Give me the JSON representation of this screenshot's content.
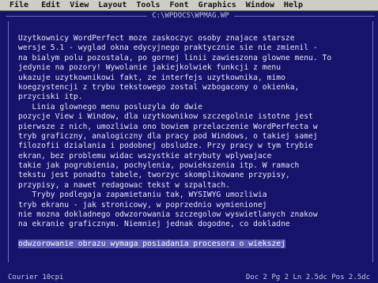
{
  "menu": {
    "items": [
      "File",
      "Edit",
      "View",
      "Layout",
      "Tools",
      "Font",
      "Graphics",
      "Window",
      "Help"
    ]
  },
  "window": {
    "title": "C:\\WPDOCS\\WPMAG.WP"
  },
  "document": {
    "lines": [
      "Uzytkownicy WordPerfect moze zaskoczyc osoby znajace starsze",
      "wersje 5.1 - wyglad okna edycyjnego praktycznie sie nie zmienil -",
      "na bialym polu pozostala, po gornej linii zawieszona glowne menu. To",
      "jedynie na pozory! Wywolanie jakiejkolwiek funkcji z menu",
      "ukazuje uzytkownikowi fakt, ze interfejs uzytkownika, mimo",
      "koegzystencji z trybu tekstowego zostal wzbogacony o okienka,",
      "przyciski itp.",
      "   Linia glownego menu posluzyla do dwie",
      "pozycje View i Window, dla uzytkownikow szczegolnie istotne jest",
      "pierwsze z nich, umozliwia ono bowiem przelaczenie WordPerfecta w",
      "tryb graficzny, analogiczny dla pracy pod Windows, o takiej samej",
      "filozofii dzialania i podobnej obsludze. Przy pracy w tym trybie",
      "ekran, bez problemu widac wszystkie atrybuty wplywajace",
      "takie jak pogrubienia, pochylenia, powiekszenia itp. W ramach",
      "tekstu jest ponadto tabele, tworzyc skomplikowane przypisy,",
      "przypisy, a nawet redagowac tekst w szpaltach.",
      "   Tryby podlegaja zapamietaniu tak, WYSIWYG umozliwia",
      "tryb ekranu - jak stronicowy, w poprzednio wymienionej",
      "nie mozna dokladnego odwzorowania szczegolow wyswietlanych znakow",
      "na ekranie graficznym. Niemniej jednak dogodne, co dokladne",
      "",
      "odwzorowanie obrazu wymaga posiadania procesora o wiekszej"
    ],
    "highlighted_line": 21
  },
  "status": {
    "font": "Courier 10cpi",
    "position": "Doc 2 Pg 2 Ln 2.5dc Pos 2.5dc"
  },
  "colors": {
    "background": "#16146a",
    "text": "#e8e8ff",
    "menubar": "#cfcfc7",
    "selection": "#5a5ab4"
  }
}
